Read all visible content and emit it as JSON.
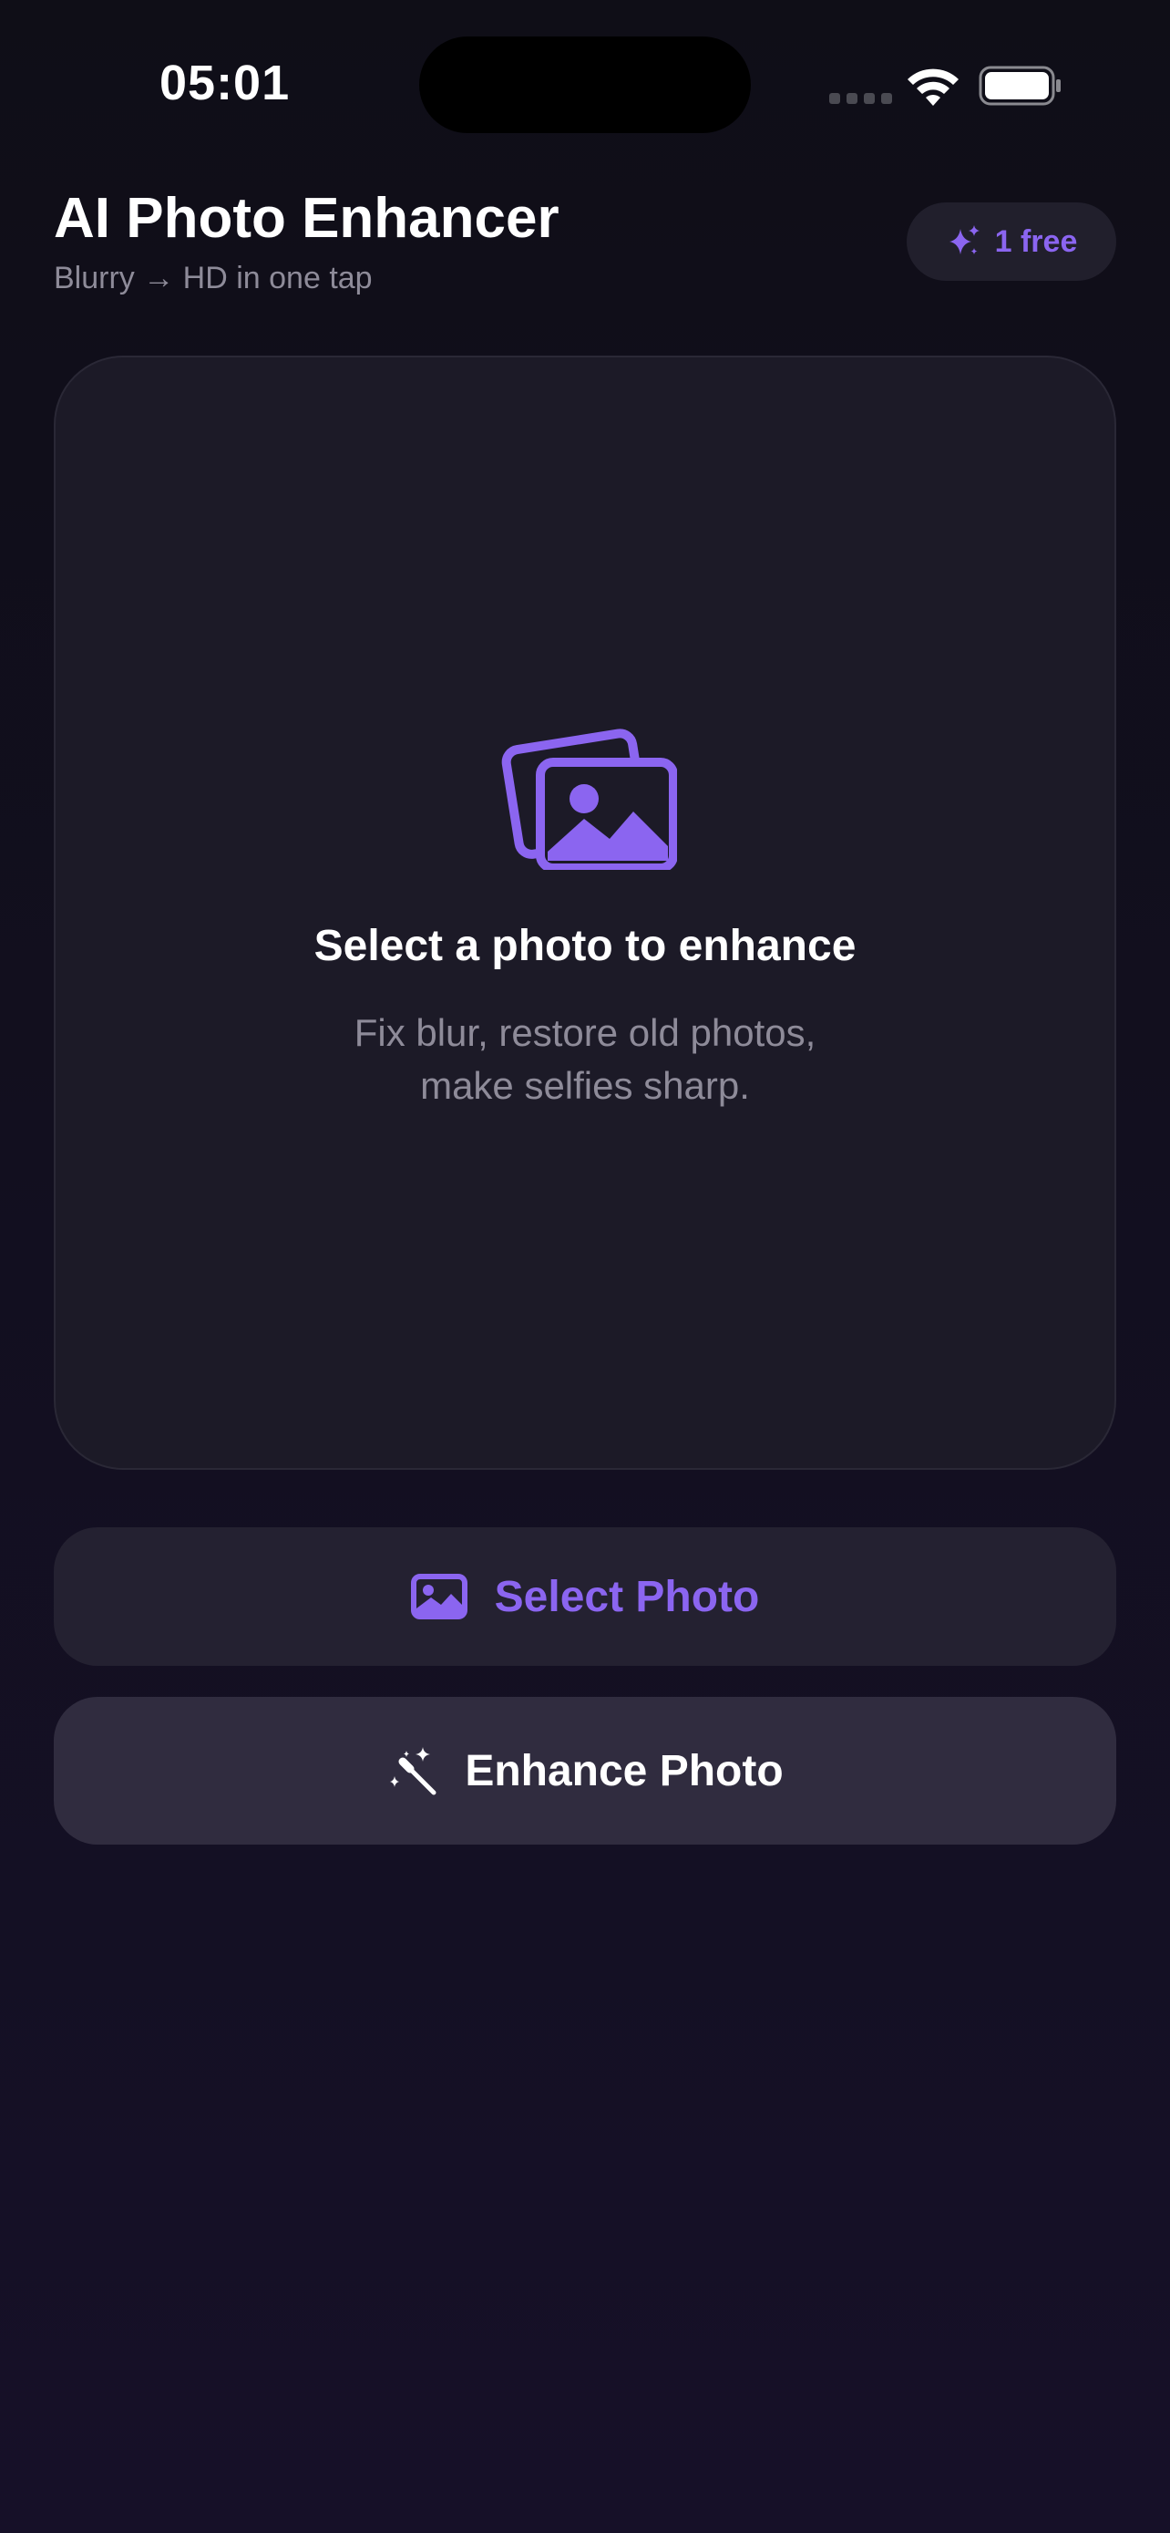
{
  "status_bar": {
    "time": "05:01"
  },
  "header": {
    "title": "AI Photo Enhancer",
    "subtitle": "Blurry → HD in one tap",
    "badge_label": "1 free"
  },
  "photo_card": {
    "title": "Select a photo to enhance",
    "description_line1": "Fix blur, restore old photos,",
    "description_line2": "make selfies sharp."
  },
  "buttons": {
    "select_label": "Select Photo",
    "enhance_label": "Enhance Photo"
  },
  "icons": {
    "badge": "sparkles-icon",
    "card": "photo-stack-icon",
    "select": "photo-icon",
    "enhance": "magic-wand-icon"
  },
  "colors": {
    "accent": "#8b65f0",
    "background": "#0f0e17",
    "card": "#1c1a27",
    "muted_text": "#8e8b99"
  }
}
